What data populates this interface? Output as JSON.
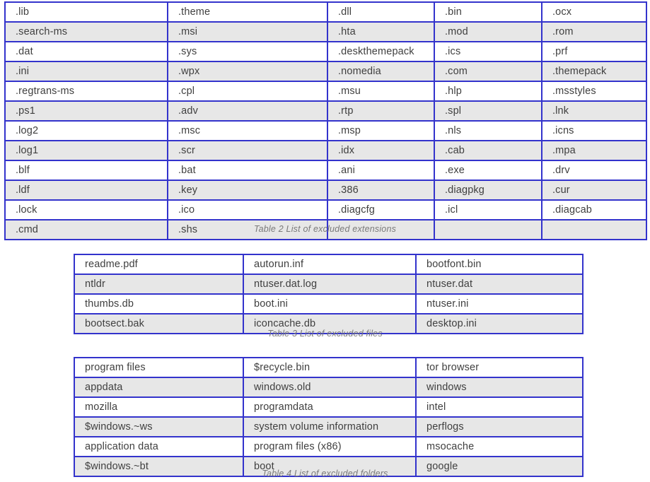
{
  "document": {
    "colors": {
      "table_border": "#3333CC",
      "shaded_row": "#E7E7E7",
      "text": "#3F3F3F",
      "caption_text": "#7A7A7A",
      "page_background": "#FFFFFF"
    }
  },
  "table_extensions": {
    "caption": "Table 2 List of excluded extensions",
    "columns": 5,
    "rows": [
      [
        ".lib",
        ".theme",
        ".dll",
        ".bin",
        ".ocx"
      ],
      [
        ".search-ms",
        ".msi",
        ".hta",
        ".mod",
        ".rom"
      ],
      [
        ".dat",
        ".sys",
        ".deskthemepack",
        ".ics",
        ".prf"
      ],
      [
        ".ini",
        ".wpx",
        ".nomedia",
        ".com",
        ".themepack"
      ],
      [
        ".regtrans-ms",
        ".cpl",
        ".msu",
        ".hlp",
        ".msstyles"
      ],
      [
        ".ps1",
        ".adv",
        ".rtp",
        ".spl",
        ".lnk"
      ],
      [
        ".log2",
        ".msc",
        ".msp",
        ".nls",
        ".icns"
      ],
      [
        ".log1",
        ".scr",
        ".idx",
        ".cab",
        ".mpa"
      ],
      [
        ".blf",
        ".bat",
        ".ani",
        ".exe",
        ".drv"
      ],
      [
        ".ldf",
        ".key",
        ".386",
        ".diagpkg",
        ".cur"
      ],
      [
        ".lock",
        ".ico",
        ".diagcfg",
        ".icl",
        ".diagcab"
      ],
      [
        ".cmd",
        ".shs",
        "",
        "",
        ""
      ]
    ]
  },
  "table_files": {
    "caption": "Table 3 List of excluded files",
    "columns": 3,
    "rows": [
      [
        "readme.pdf",
        "autorun.inf",
        "bootfont.bin"
      ],
      [
        "ntldr",
        "ntuser.dat.log",
        "ntuser.dat"
      ],
      [
        "thumbs.db",
        "boot.ini",
        "ntuser.ini"
      ],
      [
        "bootsect.bak",
        "iconcache.db",
        "desktop.ini"
      ]
    ]
  },
  "table_folders": {
    "caption": "Table 4 List of excluded folders",
    "columns": 3,
    "rows": [
      [
        "program files",
        "$recycle.bin",
        "tor browser"
      ],
      [
        "appdata",
        "windows.old",
        "windows"
      ],
      [
        "mozilla",
        "programdata",
        "intel"
      ],
      [
        "$windows.~ws",
        "system volume information",
        "perflogs"
      ],
      [
        "application data",
        "program files (x86)",
        "msocache"
      ],
      [
        "$windows.~bt",
        "boot",
        "google"
      ]
    ]
  }
}
